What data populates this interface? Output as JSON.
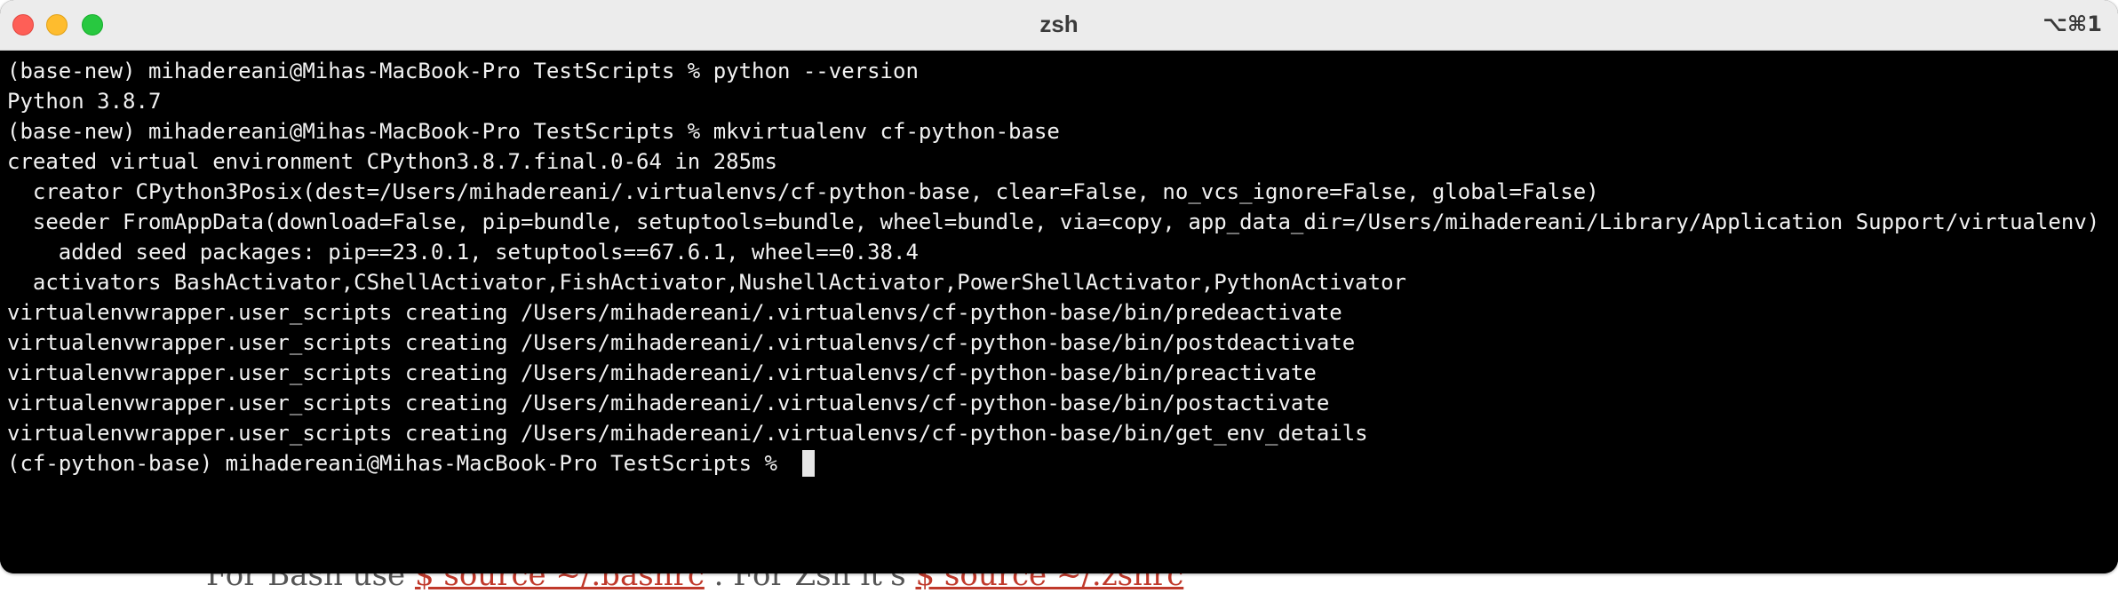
{
  "window": {
    "title": "zsh",
    "shortcut": "⌥⌘1"
  },
  "terminal": {
    "lines": [
      "(base-new) mihadereani@Mihas-MacBook-Pro TestScripts % python --version",
      "Python 3.8.7",
      "(base-new) mihadereani@Mihas-MacBook-Pro TestScripts % mkvirtualenv cf-python-base",
      "created virtual environment CPython3.8.7.final.0-64 in 285ms",
      "  creator CPython3Posix(dest=/Users/mihadereani/.virtualenvs/cf-python-base, clear=False, no_vcs_ignore=False, global=False)",
      "  seeder FromAppData(download=False, pip=bundle, setuptools=bundle, wheel=bundle, via=copy, app_data_dir=/Users/mihadereani/Library/Application Support/virtualenv)",
      "    added seed packages: pip==23.0.1, setuptools==67.6.1, wheel==0.38.4",
      "  activators BashActivator,CShellActivator,FishActivator,NushellActivator,PowerShellActivator,PythonActivator",
      "virtualenvwrapper.user_scripts creating /Users/mihadereani/.virtualenvs/cf-python-base/bin/predeactivate",
      "virtualenvwrapper.user_scripts creating /Users/mihadereani/.virtualenvs/cf-python-base/bin/postdeactivate",
      "virtualenvwrapper.user_scripts creating /Users/mihadereani/.virtualenvs/cf-python-base/bin/preactivate",
      "virtualenvwrapper.user_scripts creating /Users/mihadereani/.virtualenvs/cf-python-base/bin/postactivate",
      "virtualenvwrapper.user_scripts creating /Users/mihadereani/.virtualenvs/cf-python-base/bin/get_env_details"
    ],
    "prompt": "(cf-python-base) mihadereani@Mihas-MacBook-Pro TestScripts % "
  },
  "background_window": {
    "text_before": "For Bash use ",
    "cmd1": "$ source ~/.bashrc",
    "text_middle": " . For Zsh it's ",
    "cmd2": "$ source ~/.zshrc"
  },
  "colors": {
    "terminal_bg": "#000000",
    "terminal_fg": "#f2f2f2",
    "titlebar_bg": "#ececec",
    "close": "#fe5f57",
    "minimize": "#febc2e",
    "zoom": "#28c840"
  }
}
